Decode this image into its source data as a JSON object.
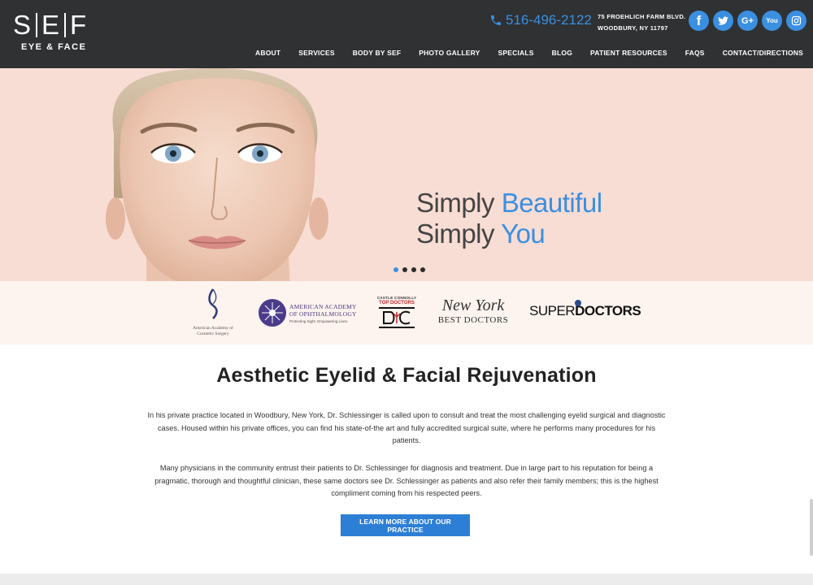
{
  "header": {
    "logo": {
      "main_left": "S",
      "main_mid": "E",
      "main_right": "F",
      "sub": "EYE & FACE"
    },
    "phone": "516-496-2122",
    "address": {
      "line1": "75 FROEHLICH FARM BLVD.",
      "line2": "WOODBURY, NY 11797"
    },
    "social": [
      {
        "name": "facebook",
        "glyph": "f"
      },
      {
        "name": "twitter",
        "glyph": ""
      },
      {
        "name": "google-plus",
        "glyph": "G+"
      },
      {
        "name": "youtube",
        "glyph": "You"
      },
      {
        "name": "instagram",
        "glyph": ""
      }
    ],
    "nav": [
      "ABOUT",
      "SERVICES",
      "BODY BY SEF",
      "PHOTO GALLERY",
      "SPECIALS",
      "BLOG",
      "PATIENT RESOURCES",
      "FAQS",
      "CONTACT/DIRECTIONS"
    ]
  },
  "hero": {
    "line1_plain": "Simply ",
    "line1_accent": "Beautiful",
    "line2_plain": "Simply ",
    "line2_accent": "You",
    "slides": 4,
    "active_slide": 1
  },
  "logos": {
    "aacs": "American Academy of Cosmetic Surgery",
    "aao_line1": "AMERICAN ACADEMY",
    "aao_line2": "OF OPHTHALMOLOGY",
    "aao_tagline": "Protecting Sight. Empowering Lives.",
    "ctd_line1": "CASTLE CONNOLLY",
    "ctd_line2": "TOP DOCTORS",
    "ny_line1": "New York",
    "ny_line2": "BEST DOCTORS",
    "sd_light": "SUPER",
    "sd_bold": "DOCTORS"
  },
  "content": {
    "heading": "Aesthetic Eyelid & Facial Rejuvenation",
    "paragraph1": "In his private practice located in Woodbury, New York, Dr. Schlessinger is called upon to consult and treat the most challenging eyelid surgical and diagnostic cases. Housed within his private offices, you can find his state-of-the art and fully accredited surgical suite, where he performs many procedures for his patients.",
    "paragraph2": "Many physicians in the community entrust their patients to Dr. Schlessinger for diagnosis and treatment. Due in large part to his reputation for being a pragmatic, thorough and thoughtful clinician, these same doctors see Dr. Schlessinger as patients and also refer their family members; this is the highest compliment coming from his respected peers.",
    "cta": "LEARN MORE ABOUT OUR PRACTICE"
  },
  "colors": {
    "header_bg": "#2f3133",
    "accent": "#3b8fe0",
    "hero_bg": "#f8ddd5",
    "cta_bg": "#2d7fd6"
  }
}
